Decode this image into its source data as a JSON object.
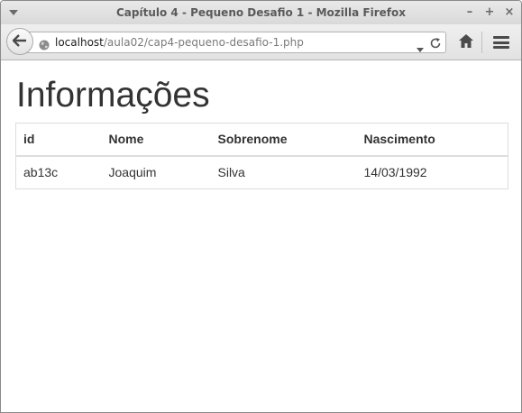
{
  "window": {
    "title": "Capítulo 4 - Pequeno Desafio 1 - Mozilla Firefox",
    "controls": {
      "minimize": "–",
      "maximize": "+",
      "close": "×"
    }
  },
  "toolbar": {
    "url_host": "localhost",
    "url_path": "/aula02/cap4-pequeno-desafio-1.php",
    "icons": [
      "back-arrow-icon",
      "globe-icon",
      "dropdown-arrow-icon",
      "reload-icon",
      "home-icon",
      "hamburger-menu-icon"
    ]
  },
  "page": {
    "heading": "Informações",
    "table": {
      "headers": [
        "id",
        "Nome",
        "Sobrenome",
        "Nascimento"
      ],
      "rows": [
        [
          "ab13c",
          "Joaquim",
          "Silva",
          "14/03/1992"
        ]
      ]
    }
  },
  "colors": {
    "titlebar": "#d9d9d9",
    "text": "#333333",
    "table_border": "#dddddd"
  }
}
